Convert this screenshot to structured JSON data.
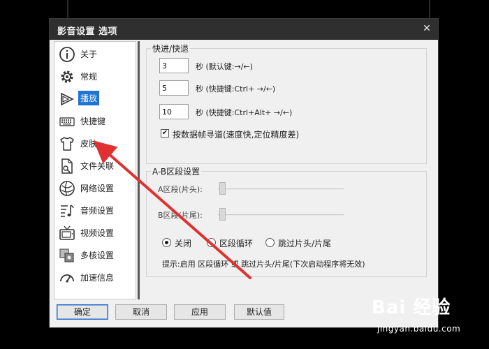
{
  "window": {
    "title": "影音设置 选项",
    "close_icon": "close-icon"
  },
  "sidebar": {
    "items": [
      {
        "label": "关于",
        "icon": "info-icon",
        "active": false
      },
      {
        "label": "常规",
        "icon": "gear-icon",
        "active": false
      },
      {
        "label": "播放",
        "icon": "play-icon",
        "active": true
      },
      {
        "label": "快捷键",
        "icon": "keyboard-icon",
        "active": false
      },
      {
        "label": "皮肤",
        "icon": "shirt-icon",
        "active": false
      },
      {
        "label": "文件关联",
        "icon": "file-link-icon",
        "active": false
      },
      {
        "label": "网络设置",
        "icon": "network-icon",
        "active": false
      },
      {
        "label": "音频设置",
        "icon": "audio-icon",
        "active": false
      },
      {
        "label": "视频设置",
        "icon": "tv-icon",
        "active": false
      },
      {
        "label": "多核设置",
        "icon": "multicore-icon",
        "active": false
      },
      {
        "label": "加速信息",
        "icon": "speedometer-icon",
        "active": false
      }
    ]
  },
  "seek": {
    "group_title": "快进/快退",
    "rows": [
      {
        "value": "3",
        "hint": "秒 (默认键:→/←)"
      },
      {
        "value": "5",
        "hint": "秒 (快捷键:Ctrl+ →/←)"
      },
      {
        "value": "10",
        "hint": "秒 (快捷键:Ctrl+Alt+ →/←)"
      }
    ],
    "keyframe_checkbox": {
      "label": "按数据帧寻道(速度快,定位精度差)",
      "checked": true
    }
  },
  "ab": {
    "group_title": "A-B区段设置",
    "a_label": "A区段(片头):",
    "b_label": "B区段(片尾):",
    "radios": [
      {
        "label": "关闭",
        "checked": true
      },
      {
        "label": "区段循环",
        "checked": false
      },
      {
        "label": "跳过片头/片尾",
        "checked": false
      }
    ],
    "tip": "提示:启用 区段循环 或 跳过片头/片尾(下次启动程序将无效)"
  },
  "buttons": {
    "ok": "确定",
    "cancel": "取消",
    "apply": "应用",
    "default": "默认值"
  },
  "watermark": {
    "brand": "Bai 经验",
    "url": "jingyan.baidu.com"
  },
  "colors": {
    "accent": "#1e73d6",
    "arrow": "#e03030",
    "titlebar": "#2f2f2f"
  }
}
